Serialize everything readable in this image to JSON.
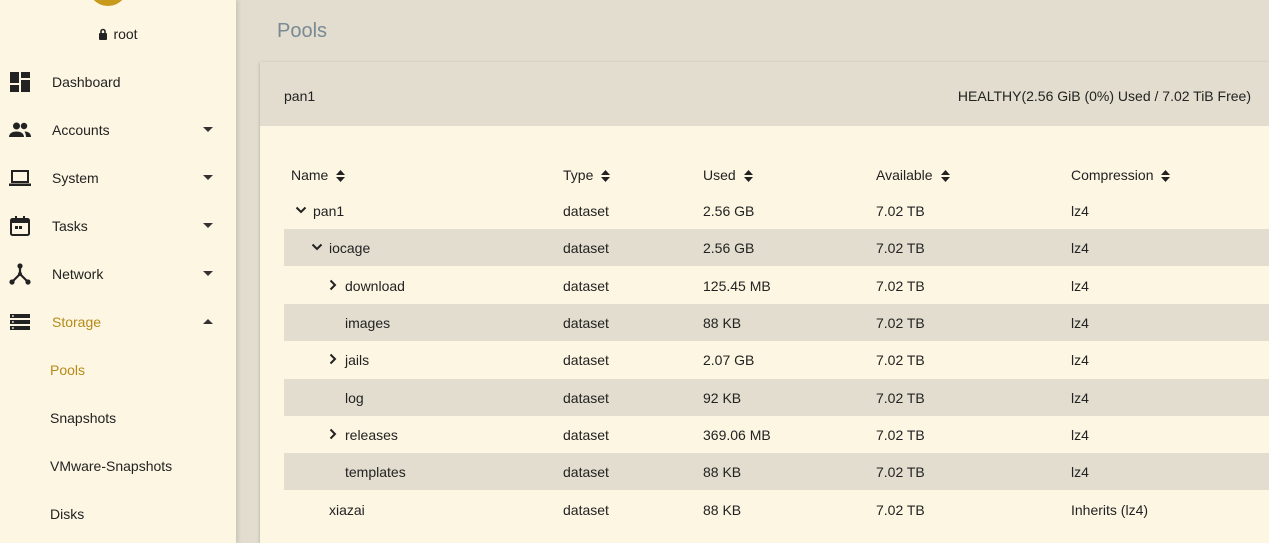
{
  "sidebar": {
    "username": "root",
    "nav": [
      {
        "key": "dashboard",
        "label": "Dashboard",
        "icon": "dashboard-icon",
        "expandable": false
      },
      {
        "key": "accounts",
        "label": "Accounts",
        "icon": "people-icon",
        "expandable": true
      },
      {
        "key": "system",
        "label": "System",
        "icon": "laptop-icon",
        "expandable": true
      },
      {
        "key": "tasks",
        "label": "Tasks",
        "icon": "calendar-icon",
        "expandable": true
      },
      {
        "key": "network",
        "label": "Network",
        "icon": "network-icon",
        "expandable": true
      },
      {
        "key": "storage",
        "label": "Storage",
        "icon": "storage-icon",
        "expandable": true,
        "expanded": true,
        "active": true
      }
    ],
    "storage_sub": [
      {
        "label": "Pools",
        "active": true
      },
      {
        "label": "Snapshots"
      },
      {
        "label": "VMware-Snapshots"
      },
      {
        "label": "Disks"
      }
    ]
  },
  "page": {
    "title": "Pools"
  },
  "pool": {
    "name": "pan1",
    "status": "HEALTHY(2.56 GiB (0%) Used / 7.02 TiB Free)"
  },
  "table": {
    "columns": [
      "Name",
      "Type",
      "Used",
      "Available",
      "Compression"
    ],
    "rows": [
      {
        "name": "pan1",
        "type": "dataset",
        "used": "2.56 GB",
        "available": "7.02 TB",
        "compression": "lz4",
        "toggle": "expanded"
      },
      {
        "name": "iocage",
        "type": "dataset",
        "used": "2.56 GB",
        "available": "7.02 TB",
        "compression": "lz4",
        "toggle": "expanded"
      },
      {
        "name": "download",
        "type": "dataset",
        "used": "125.45 MB",
        "available": "7.02 TB",
        "compression": "lz4",
        "toggle": "collapsed"
      },
      {
        "name": "images",
        "type": "dataset",
        "used": "88 KB",
        "available": "7.02 TB",
        "compression": "lz4",
        "toggle": "none"
      },
      {
        "name": "jails",
        "type": "dataset",
        "used": "2.07 GB",
        "available": "7.02 TB",
        "compression": "lz4",
        "toggle": "collapsed"
      },
      {
        "name": "log",
        "type": "dataset",
        "used": "92 KB",
        "available": "7.02 TB",
        "compression": "lz4",
        "toggle": "none"
      },
      {
        "name": "releases",
        "type": "dataset",
        "used": "369.06 MB",
        "available": "7.02 TB",
        "compression": "lz4",
        "toggle": "collapsed"
      },
      {
        "name": "templates",
        "type": "dataset",
        "used": "88 KB",
        "available": "7.02 TB",
        "compression": "lz4",
        "toggle": "none"
      },
      {
        "name": "xiazai",
        "type": "dataset",
        "used": "88 KB",
        "available": "7.02 TB",
        "compression": "Inherits (lz4)",
        "toggle": "none"
      }
    ]
  },
  "colors": {
    "accent": "#b58a17",
    "sidebar_bg": "#fdf6e3",
    "header_bg": "#e2ddce",
    "title_text": "#7a8a95"
  }
}
